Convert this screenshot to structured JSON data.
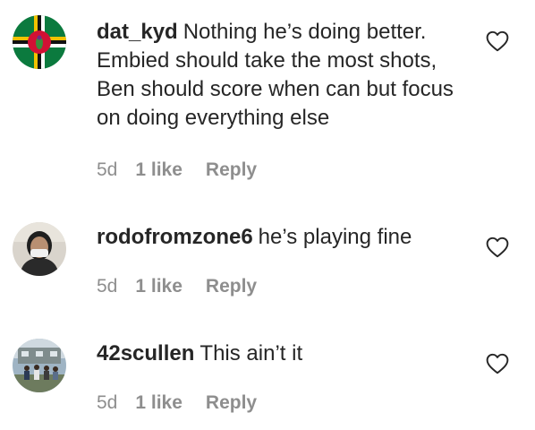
{
  "comments": [
    {
      "username": "dat_kyd",
      "text": "Nothing he’s doing better. Embied should take the most shots, Ben should score when can but focus on doing everything else",
      "time": "5d",
      "likes": "1 like",
      "reply_label": "Reply",
      "avatar_icon": "dominica-flag-avatar",
      "liked": false
    },
    {
      "username": "rodofromzone6",
      "text": "he’s playing fine",
      "time": "5d",
      "likes": "1 like",
      "reply_label": "Reply",
      "avatar_icon": "person-with-mask-avatar",
      "liked": false
    },
    {
      "username": "42scullen",
      "text": "This ain’t it",
      "time": "5d",
      "likes": "1 like",
      "reply_label": "Reply",
      "avatar_icon": "group-photo-avatar",
      "liked": false
    }
  ],
  "colors": {
    "text": "#262626",
    "secondary": "#8e8e8e",
    "heart_outline": "#262626"
  }
}
